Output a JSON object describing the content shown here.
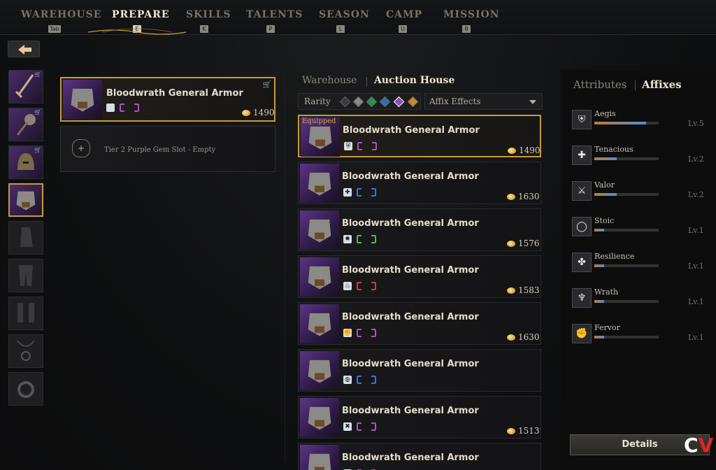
{
  "nav": {
    "items": [
      {
        "label": "WAREHOUSE",
        "key": "Tab"
      },
      {
        "label": "PREPARE",
        "key": "E"
      },
      {
        "label": "SKILLS",
        "key": "K"
      },
      {
        "label": "TALENTS",
        "key": "P"
      },
      {
        "label": "SEASON",
        "key": "L"
      },
      {
        "label": "CAMP",
        "key": "U"
      },
      {
        "label": "MISSION",
        "key": "8"
      }
    ],
    "active": "PREPARE"
  },
  "selected_item": {
    "name": "Bloodwrath General Armor",
    "price": "1490",
    "gem_slot_text": "Tier 2 Purple Gem Slot - Empty"
  },
  "market": {
    "tabs": [
      "Warehouse",
      "Auction House"
    ],
    "active_tab": "Auction House",
    "rarity_label": "Rarity",
    "affix_filter_label": "Affix Effects",
    "equipped_label": "Equipped",
    "rows": [
      {
        "name": "Bloodwrath General Armor",
        "price": "1490",
        "affix_icon": "shield-icon",
        "gem_color": "#b04fc4",
        "equipped": true
      },
      {
        "name": "Bloodwrath General Armor",
        "price": "1630",
        "affix_icon": "heart-cross-icon",
        "gem_color": "#3c6fe0",
        "equipped": false
      },
      {
        "name": "Bloodwrath General Armor",
        "price": "1576",
        "affix_icon": "gear-icon",
        "gem_color": "#3fbf5a",
        "equipped": false
      },
      {
        "name": "Bloodwrath General Armor",
        "price": "1583",
        "affix_icon": "flame-icon",
        "gem_color": "#d03a3a",
        "equipped": false
      },
      {
        "name": "Bloodwrath General Armor",
        "price": "1630",
        "affix_icon": "fist-icon",
        "gem_color": "#b04fc4",
        "equipped": false
      },
      {
        "name": "Bloodwrath General Armor",
        "price": "",
        "affix_icon": "swirl-icon",
        "gem_color": "#3c6fe0",
        "equipped": false
      },
      {
        "name": "Bloodwrath General Armor",
        "price": "1513",
        "affix_icon": "cross-icon",
        "gem_color": "#b04fc4",
        "equipped": false
      },
      {
        "name": "Bloodwrath General Armor",
        "price": "",
        "affix_icon": "shield-icon",
        "gem_color": "#b04fc4",
        "equipped": false
      }
    ]
  },
  "attributes": {
    "tabs": [
      "Attributes",
      "Affixes"
    ],
    "active_tab": "Affixes",
    "affixes": [
      {
        "name": "Aegis",
        "level": "Lv.5",
        "fill": 0.8,
        "glyph": "⛨"
      },
      {
        "name": "Tenacious",
        "level": "Lv.2",
        "fill": 0.35,
        "glyph": "✚"
      },
      {
        "name": "Valor",
        "level": "Lv.2",
        "fill": 0.35,
        "glyph": "⚔"
      },
      {
        "name": "Stoic",
        "level": "Lv.1",
        "fill": 0.15,
        "glyph": "◯"
      },
      {
        "name": "Resilience",
        "level": "Lv.1",
        "fill": 0.15,
        "glyph": "✤"
      },
      {
        "name": "Wrath",
        "level": "Lv.1",
        "fill": 0.15,
        "glyph": "♆"
      },
      {
        "name": "Fervor",
        "level": "Lv.1",
        "fill": 0.15,
        "glyph": "✊"
      }
    ]
  },
  "details_label": "Details",
  "watermark": {
    "c": "C",
    "v": "V"
  },
  "colors": {
    "gold": "#c79a3a",
    "purple_thumb": "#5b3587",
    "bar_blue": "#4b8fd6",
    "bar_orange": "#c77a2a"
  }
}
